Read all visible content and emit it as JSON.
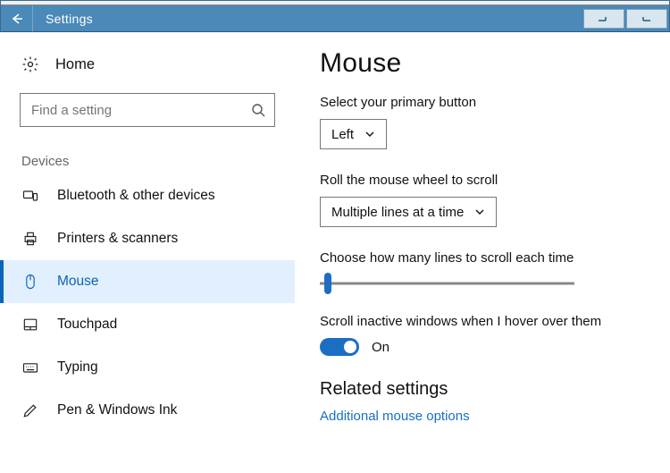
{
  "window": {
    "title": "Settings"
  },
  "sidebar": {
    "home": "Home",
    "search_placeholder": "Find a setting",
    "section": "Devices",
    "items": [
      {
        "label": "Bluetooth & other devices"
      },
      {
        "label": "Printers & scanners"
      },
      {
        "label": "Mouse"
      },
      {
        "label": "Touchpad"
      },
      {
        "label": "Typing"
      },
      {
        "label": "Pen & Windows Ink"
      }
    ]
  },
  "content": {
    "title": "Mouse",
    "primary_label": "Select your primary button",
    "primary_value": "Left",
    "wheel_label": "Roll the mouse wheel to scroll",
    "wheel_value": "Multiple lines at a time",
    "lines_label": "Choose how many lines to scroll each time",
    "inactive_label": "Scroll inactive windows when I hover over them",
    "toggle_state": "On",
    "related_heading": "Related settings",
    "related_link": "Additional mouse options"
  }
}
